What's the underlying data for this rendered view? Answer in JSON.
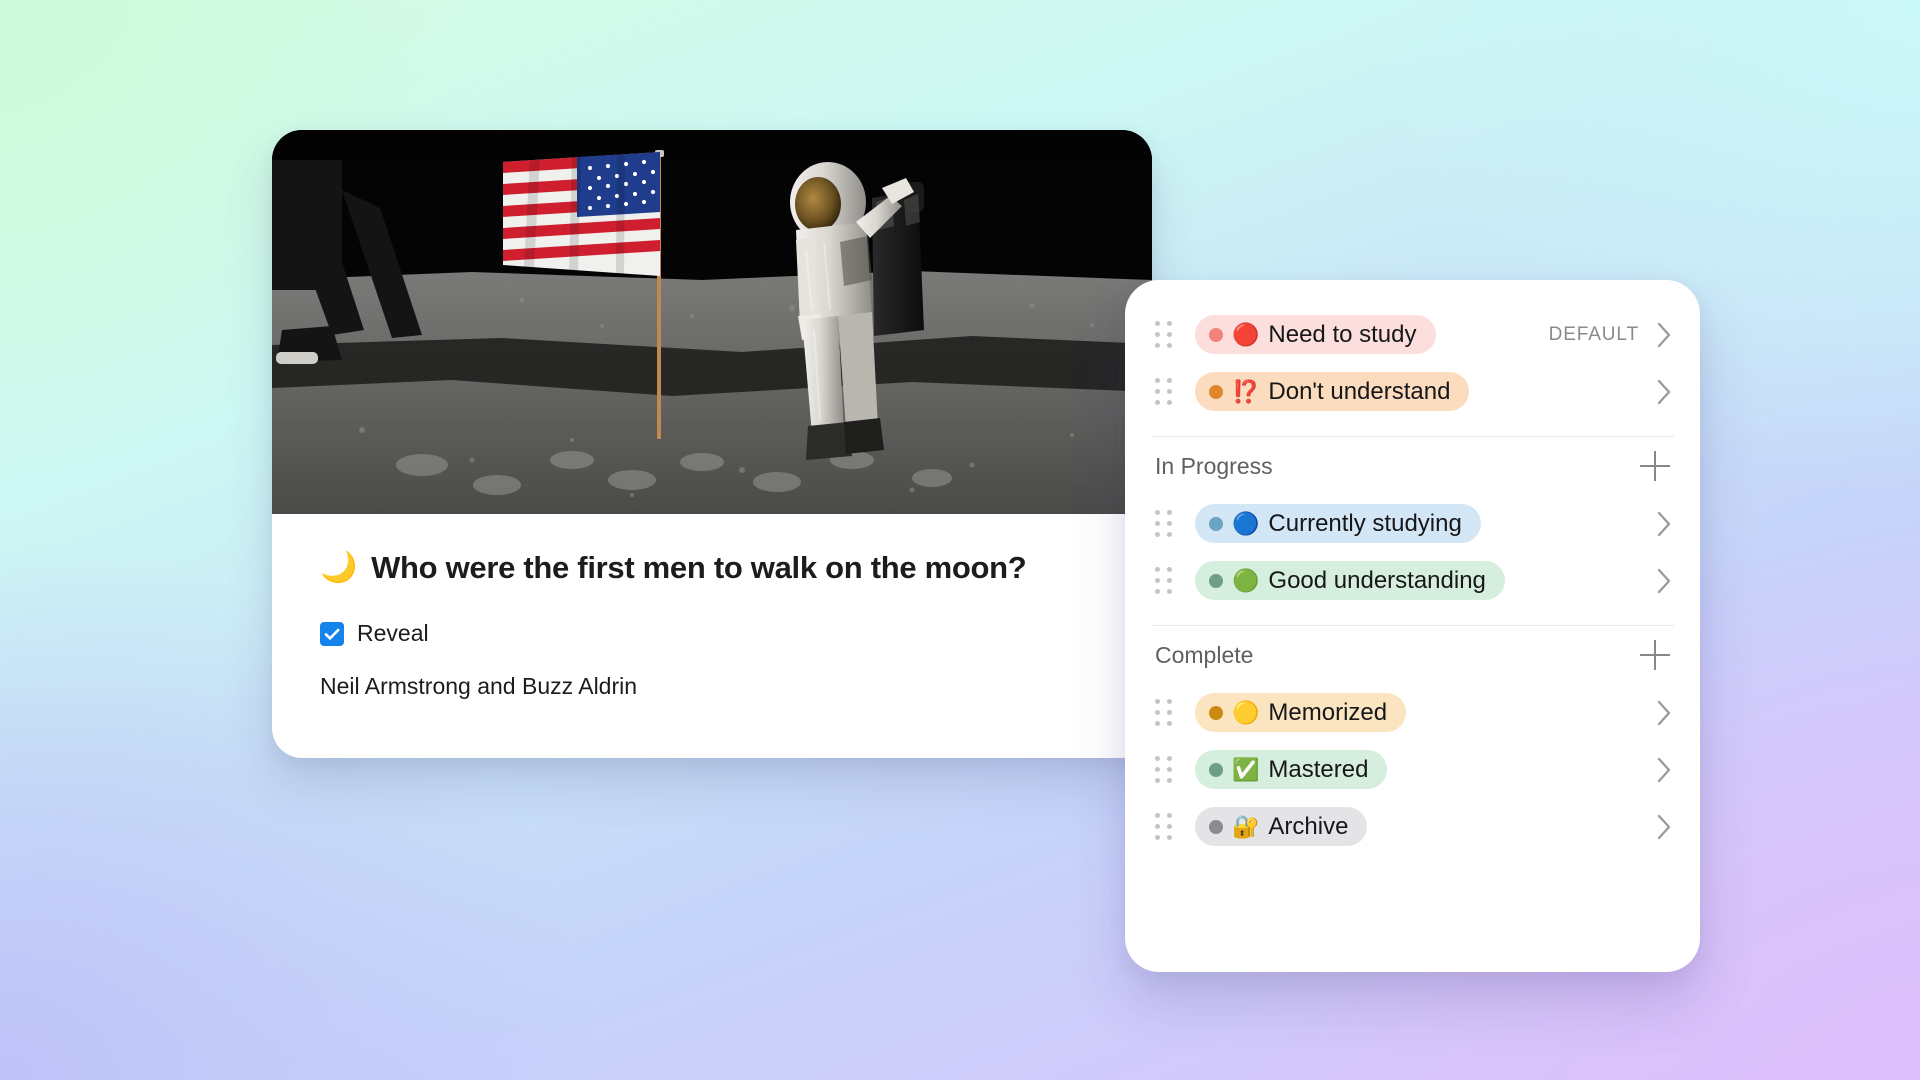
{
  "background": {
    "corner_colors": {
      "top_left": "#ccfada",
      "top_right": "#cbf8f8",
      "bottom_left": "#bfc2f8",
      "bottom_right": "#dcc0fb"
    }
  },
  "flashcard": {
    "photo_alt": "astronaut-on-moon-with-us-flag",
    "moon_emoji": "🌙",
    "question": "Who were the first men to walk on the moon?",
    "reveal_label": "Reveal",
    "reveal_checked": true,
    "answer": "Neil Armstrong and Buzz Aldrin",
    "checkbox_color": "#1583ec"
  },
  "status_panel": {
    "top_items": [
      {
        "emoji": "🔴",
        "label": "Need to study",
        "dot_color": "#f2827e",
        "pill_bg": "#fcdfdd",
        "badge": "DEFAULT",
        "chevron": "chevron-right-icon"
      },
      {
        "emoji": "⁉️",
        "label": "Don't understand",
        "dot_color": "#e0862a",
        "pill_bg": "#fbdcbe",
        "badge": "",
        "chevron": "chevron-right-icon"
      }
    ],
    "sections": [
      {
        "title": "In Progress",
        "add_label": "+",
        "items": [
          {
            "emoji": "🔵",
            "label": "Currently studying",
            "dot_color": "#6ba3c2",
            "pill_bg": "#d2e6f5",
            "chevron": "chevron-right-icon"
          },
          {
            "emoji": "🟢",
            "label": "Good understanding",
            "dot_color": "#6f9e87",
            "pill_bg": "#d6eedd",
            "chevron": "chevron-right-icon"
          }
        ]
      },
      {
        "title": "Complete",
        "add_label": "+",
        "items": [
          {
            "emoji": "🟡",
            "label": "Memorized",
            "dot_color": "#cc8a14",
            "pill_bg": "#fbe5c0",
            "chevron": "chevron-right-icon"
          },
          {
            "emoji": "✅",
            "label": "Mastered",
            "dot_color": "#6f9e87",
            "pill_bg": "#d6eedd",
            "chevron": "chevron-right-icon"
          },
          {
            "emoji": "🔐",
            "label": "Archive",
            "dot_color": "#8b8b8f",
            "pill_bg": "#e4e4e6",
            "chevron": "chevron-right-icon"
          }
        ]
      }
    ]
  }
}
